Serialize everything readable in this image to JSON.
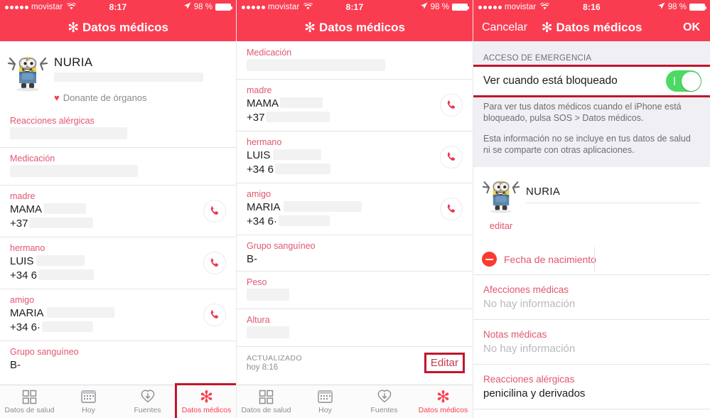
{
  "statusbar": {
    "carrier": "movistar",
    "time_1": "8:17",
    "time_2": "8:17",
    "time_3": "8:16",
    "battery": "98 %"
  },
  "panel1": {
    "nav": {
      "title": "Datos médicos",
      "asterisk": "✻"
    },
    "profile": {
      "name": "NURIA",
      "donor": "Donante de órganos",
      "heart": "♥"
    },
    "fields": [
      {
        "label": "Reacciones alérgicas",
        "value": "",
        "redact_w": 165,
        "type": "text"
      },
      {
        "label": "Medicación",
        "value": "",
        "redact_w": 180,
        "type": "text"
      },
      {
        "label": "madre",
        "value": "MAMA",
        "redact_w": 60,
        "phone": "+37",
        "phone_redact_w": 90,
        "type": "contact"
      },
      {
        "label": "hermano",
        "value": "LUIS",
        "redact_w": 68,
        "phone": "+34 6",
        "phone_redact_w": 78,
        "type": "contact"
      },
      {
        "label": "amigo",
        "value": "MARIA",
        "redact_w": 95,
        "phone": "+34 6·",
        "phone_redact_w": 72,
        "type": "contact"
      },
      {
        "label": "Grupo sanguíneo",
        "value": "B-",
        "type": "plain"
      }
    ],
    "tabs": [
      {
        "label": "Datos de salud",
        "icon": "grid-icon",
        "active": false
      },
      {
        "label": "Hoy",
        "icon": "calendar-icon",
        "active": false
      },
      {
        "label": "Fuentes",
        "icon": "download-heart-icon",
        "active": false
      },
      {
        "label": "Datos médicos",
        "icon": "asterisk-icon",
        "active": true,
        "highlighted": true
      }
    ]
  },
  "panel2": {
    "nav": {
      "title": "Datos médicos",
      "asterisk": "✻"
    },
    "fields": [
      {
        "label": "Medicación",
        "value": "",
        "redact_w": 195,
        "type": "text"
      },
      {
        "label": "madre",
        "value": "MAMA",
        "redact_w": 60,
        "phone": "+37",
        "phone_redact_w": 90,
        "type": "contact"
      },
      {
        "label": "hermano",
        "value": "LUIS",
        "redact_w": 68,
        "phone": "+34 6",
        "phone_redact_w": 78,
        "type": "contact"
      },
      {
        "label": "amigo",
        "value": "MARIA",
        "redact_w": 110,
        "phone": "+34 6·",
        "phone_redact_w": 72,
        "type": "contact"
      },
      {
        "label": "Grupo sanguíneo",
        "value": "B-",
        "type": "plain"
      },
      {
        "label": "Peso",
        "value": "",
        "redact_w": 60,
        "type": "text"
      },
      {
        "label": "Altura",
        "value": "",
        "redact_w": 60,
        "type": "text"
      }
    ],
    "updated": {
      "key": "ACTUALIZADO",
      "value": "hoy 8:16",
      "edit_label": "Editar"
    },
    "tabs": [
      {
        "label": "Datos de salud",
        "icon": "grid-icon",
        "active": false
      },
      {
        "label": "Hoy",
        "icon": "calendar-icon",
        "active": false
      },
      {
        "label": "Fuentes",
        "icon": "download-heart-icon",
        "active": false
      },
      {
        "label": "Datos médicos",
        "icon": "asterisk-icon",
        "active": true,
        "highlighted": false
      }
    ]
  },
  "panel3": {
    "nav": {
      "cancel": "Cancelar",
      "title": "Datos médicos",
      "asterisk": "✻",
      "ok": "OK"
    },
    "emergency": {
      "section_header": "ACCESO DE EMERGENCIA",
      "toggle_label": "Ver cuando está bloqueado",
      "toggle_on": true,
      "toggle_color": "#4cd964",
      "footer_1": "Para ver tus datos médicos cuando el iPhone está bloqueado, pulsa SOS > Datos médicos.",
      "footer_2": "Esta información no se incluye en tus datos de salud ni se comparte con otras aplicaciones."
    },
    "edit_profile": {
      "name": "NURIA",
      "edit_link": "editar"
    },
    "dob_row": {
      "label": "Fecha de nacimiento",
      "value": ""
    },
    "fields": [
      {
        "label": "Afecciones médicas",
        "value": "No hay información",
        "empty": true
      },
      {
        "label": "Notas médicas",
        "value": "No hay información",
        "empty": true
      },
      {
        "label": "Reacciones alérgicas",
        "value": "penicilina y derivados",
        "empty": false
      }
    ]
  },
  "colors": {
    "brand_red": "#fa3c50",
    "label_pink": "#e2566f",
    "highlight_red": "#c1162c",
    "toggle_green": "#4cd964",
    "delete_red": "#fc3b30"
  }
}
